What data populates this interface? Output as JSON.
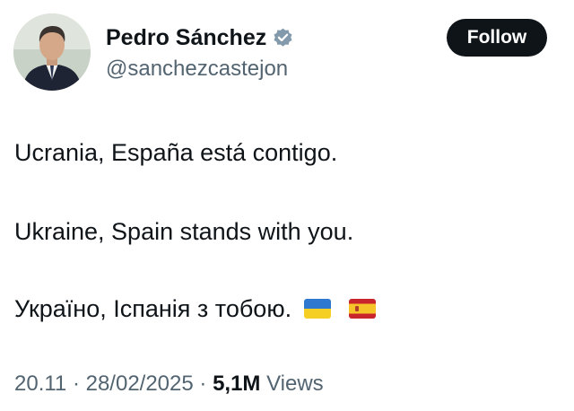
{
  "author": {
    "display_name": "Pedro Sánchez",
    "handle": "@sanchezcastejon",
    "verified_icon": "verified-badge-gray"
  },
  "actions": {
    "follow_label": "Follow"
  },
  "tweet": {
    "lines": [
      "Ucrania, España está contigo.",
      "Ukraine, Spain stands with you.",
      "Україно, Іспанія з тобою."
    ],
    "flags": [
      "ukraine-flag",
      "spain-flag"
    ]
  },
  "meta": {
    "time": "20.11",
    "separator": " · ",
    "date": "28/02/2025",
    "views_count": "5,1M",
    "views_label": "Views"
  },
  "colors": {
    "text": "#0f1419",
    "secondary": "#536471",
    "button": "#0f1419",
    "verified_badge": "#829aab"
  }
}
